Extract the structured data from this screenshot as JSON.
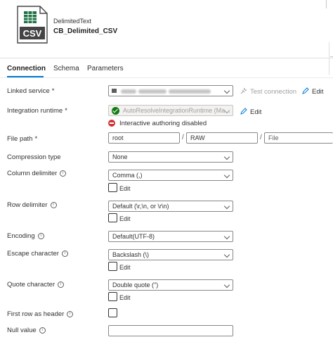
{
  "dataset": {
    "type": "DelimitedText",
    "name": "CB_Delimited_CSV",
    "icon_text": "CSV"
  },
  "tabs": [
    {
      "label": "Connection",
      "active": true
    },
    {
      "label": "Schema",
      "active": false
    },
    {
      "label": "Parameters",
      "active": false
    }
  ],
  "fields": {
    "linked_service": {
      "label": "Linked service",
      "required": "*",
      "test_label": "Test connection",
      "edit_label": "Edit"
    },
    "integration_runtime": {
      "label": "Integration runtime",
      "required": "*",
      "value": "AutoResolveIntegrationRuntime (Ma...",
      "edit_label": "Edit",
      "warning": "Interactive authoring disabled"
    },
    "file_path": {
      "label": "File path",
      "required": "*",
      "container": "root",
      "directory": "RAW",
      "file_placeholder": "File",
      "separator": "/"
    },
    "compression_type": {
      "label": "Compression type",
      "value": "None"
    },
    "column_delimiter": {
      "label": "Column delimiter",
      "value": "Comma (,)",
      "edit_label": "Edit"
    },
    "row_delimiter": {
      "label": "Row delimiter",
      "value": "Default (\\r,\\n, or \\r\\n)",
      "edit_label": "Edit"
    },
    "encoding": {
      "label": "Encoding",
      "value": "Default(UTF-8)"
    },
    "escape_character": {
      "label": "Escape character",
      "value": "Backslash (\\)",
      "edit_label": "Edit"
    },
    "quote_character": {
      "label": "Quote character",
      "value": "Double quote (\")",
      "edit_label": "Edit"
    },
    "first_row_as_header": {
      "label": "First row as header",
      "checked": false
    },
    "null_value": {
      "label": "Null value",
      "value": ""
    }
  },
  "info_glyph": "i",
  "colors": {
    "accent": "#0078d4",
    "success": "#107c10",
    "error": "#d13438",
    "csv_green": "#217346"
  }
}
